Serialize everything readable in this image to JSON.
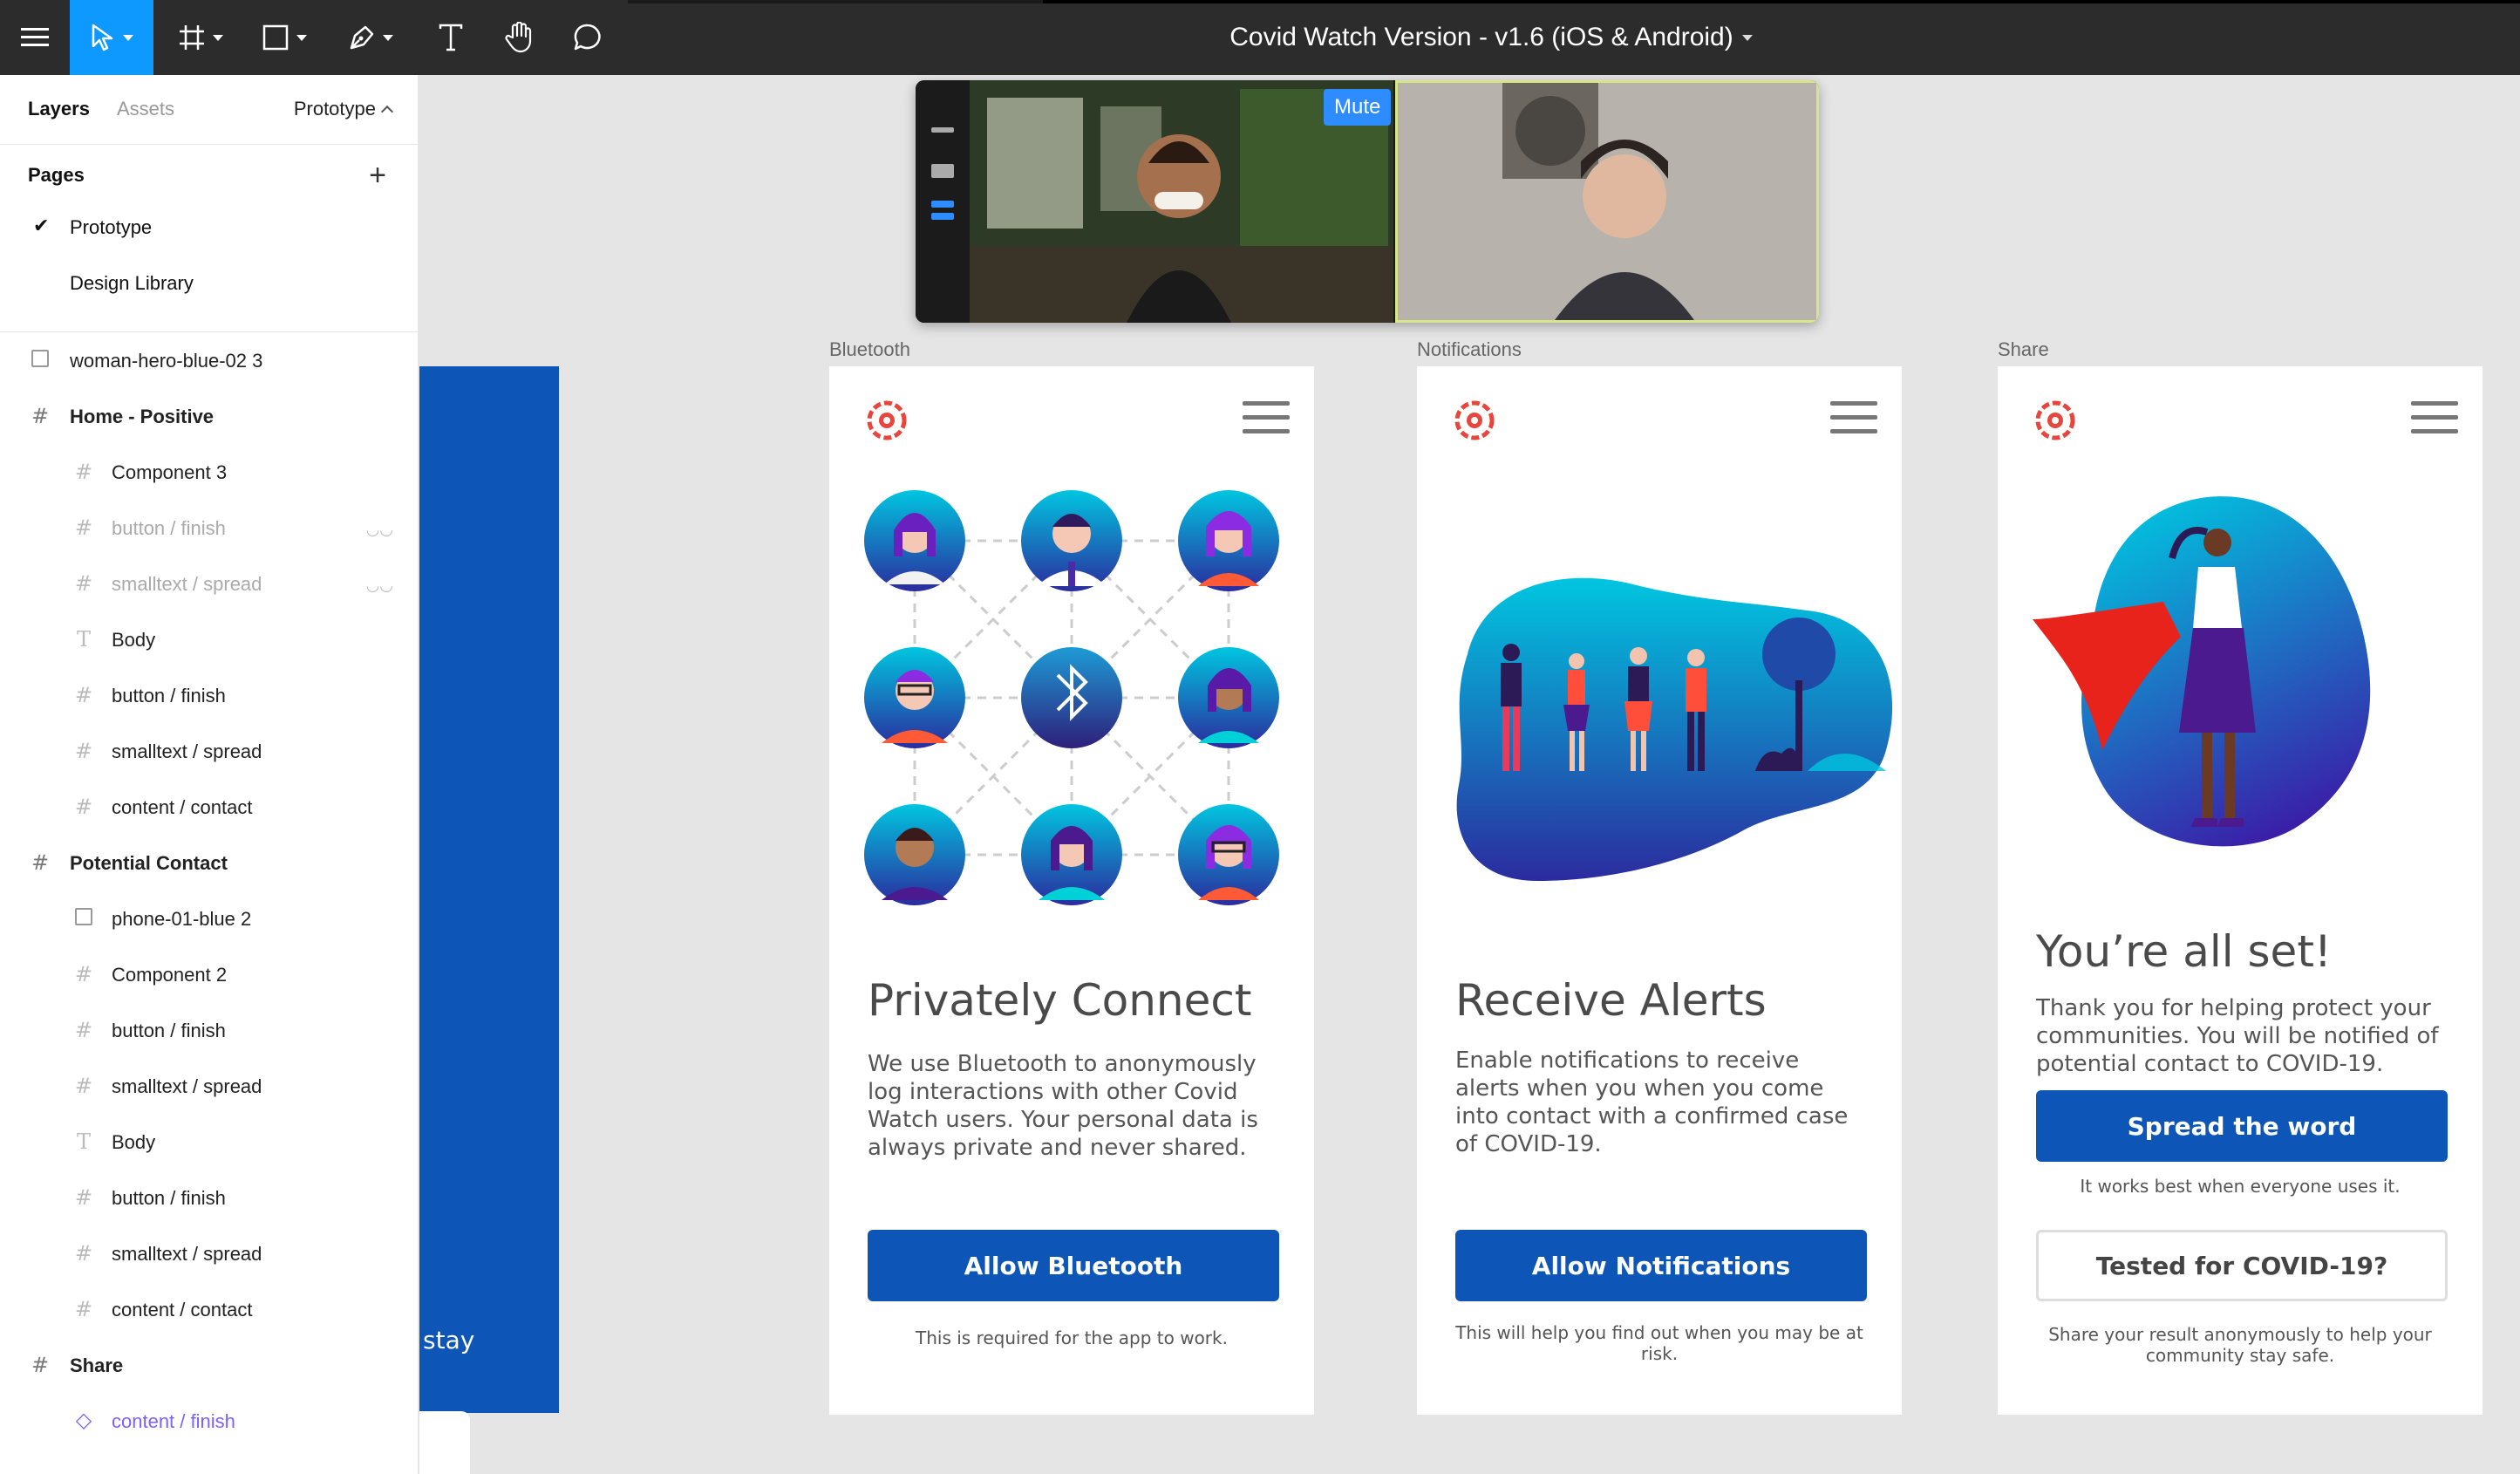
{
  "toolbar": {
    "document_title": "Covid Watch Version - v1.6 (iOS & Android)"
  },
  "left_panel": {
    "tabs": {
      "layers": "Layers",
      "assets": "Assets",
      "page_selector": "Prototype"
    },
    "pages_heading": "Pages",
    "pages": [
      {
        "label": "Prototype",
        "checked": true
      },
      {
        "label": "Design Library",
        "checked": false
      }
    ],
    "layers": [
      {
        "label": "woman-hero-blue-02 3",
        "type": "image",
        "level": 0
      },
      {
        "label": "Home - Positive",
        "type": "frame",
        "level": 0
      },
      {
        "label": "Component 3",
        "type": "frame",
        "level": 1
      },
      {
        "label": "button / finish",
        "type": "frame",
        "level": 1,
        "hidden": true
      },
      {
        "label": "smalltext / spread",
        "type": "frame",
        "level": 1,
        "hidden": true
      },
      {
        "label": "Body",
        "type": "text",
        "level": 1
      },
      {
        "label": "button / finish",
        "type": "frame",
        "level": 1
      },
      {
        "label": "smalltext / spread",
        "type": "frame",
        "level": 1
      },
      {
        "label": "content / contact",
        "type": "frame",
        "level": 1
      },
      {
        "label": "Potential Contact",
        "type": "frame",
        "level": 0
      },
      {
        "label": "phone-01-blue 2",
        "type": "image",
        "level": 1
      },
      {
        "label": "Component 2",
        "type": "frame",
        "level": 1
      },
      {
        "label": "button / finish",
        "type": "frame",
        "level": 1
      },
      {
        "label": "smalltext / spread",
        "type": "frame",
        "level": 1
      },
      {
        "label": "Body",
        "type": "text",
        "level": 1
      },
      {
        "label": "button / finish",
        "type": "frame",
        "level": 1
      },
      {
        "label": "smalltext / spread",
        "type": "frame",
        "level": 1
      },
      {
        "label": "content / contact",
        "type": "frame",
        "level": 1
      },
      {
        "label": "Share",
        "type": "frame",
        "level": 0
      },
      {
        "label": "content / finish",
        "type": "component",
        "level": 1
      }
    ]
  },
  "video_call": {
    "mute_label": "Mute",
    "more_label": "···"
  },
  "canvas": {
    "partial_frame_text": "stay",
    "frames": {
      "bluetooth": {
        "label": "Bluetooth",
        "title": "Privately Connect",
        "body": "We use Bluetooth to anonymously log interactions with other Covid Watch users. Your personal data is always private and never shared.",
        "button": "Allow Bluetooth",
        "note": "This is required for the app to work."
      },
      "notifications": {
        "label": "Notifications",
        "title": "Receive Alerts",
        "body": "Enable notifications to receive alerts when you when you come into contact with a confirmed case of COVID-19.",
        "button": "Allow Notifications",
        "note": "This will help you find out when you may be at risk."
      },
      "share": {
        "label": "Share",
        "title": "You’re all set!",
        "body": "Thank you for helping protect your communities. You will be notified of potential contact to COVID-19.",
        "button": "Spread the word",
        "button_note": "It works best when everyone uses it.",
        "button2": "Tested for COVID-19?",
        "note": "Share your result anonymously to help your community stay safe."
      }
    }
  },
  "colors": {
    "toolbar_bg": "#2c2c2c",
    "active_tool": "#0d99ff",
    "brand_blue": "#0d55b6",
    "logo_red": "#e8463c",
    "component_purple": "#7b61ff"
  }
}
